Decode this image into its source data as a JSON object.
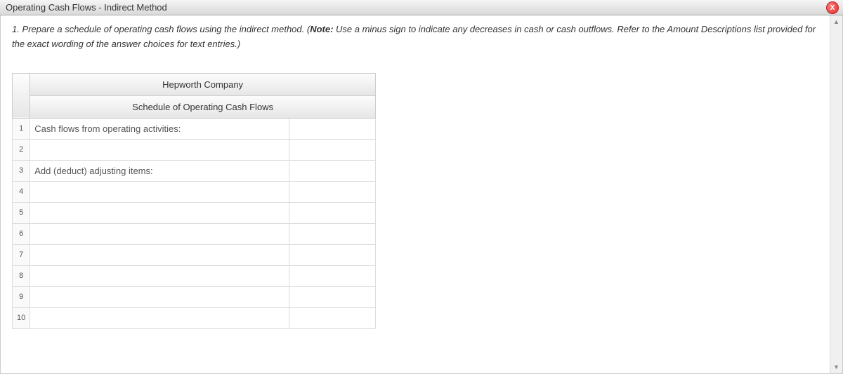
{
  "window": {
    "title": "Operating Cash Flows - Indirect Method",
    "close_label": "X"
  },
  "instructions": {
    "prefix": "1. Prepare a schedule of operating cash flows using the indirect method. (",
    "note_label": "Note:",
    "body": " Use a minus sign to indicate any decreases in cash or cash outflows. Refer to the Amount Descriptions list provided for the exact wording of the answer choices for text entries.)"
  },
  "schedule": {
    "company": "Hepworth Company",
    "title": "Schedule of Operating Cash Flows",
    "rows": [
      {
        "num": "1",
        "desc": "Cash flows from operating activities:",
        "amount": ""
      },
      {
        "num": "2",
        "desc": "",
        "amount": ""
      },
      {
        "num": "3",
        "desc": "Add (deduct) adjusting items:",
        "amount": ""
      },
      {
        "num": "4",
        "desc": "",
        "amount": ""
      },
      {
        "num": "5",
        "desc": "",
        "amount": ""
      },
      {
        "num": "6",
        "desc": "",
        "amount": ""
      },
      {
        "num": "7",
        "desc": "",
        "amount": ""
      },
      {
        "num": "8",
        "desc": "",
        "amount": ""
      },
      {
        "num": "9",
        "desc": "",
        "amount": ""
      },
      {
        "num": "10",
        "desc": "",
        "amount": ""
      }
    ]
  }
}
